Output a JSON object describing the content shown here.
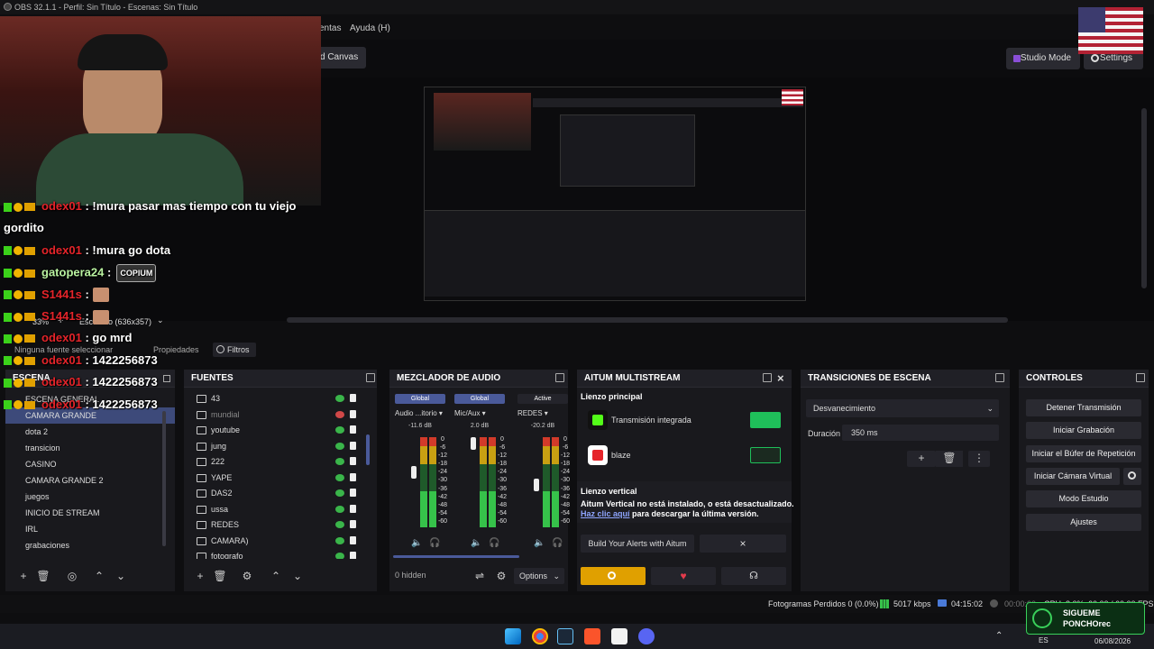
{
  "window": {
    "title": "OBS 32.1.1 - Perfil: Sin Título - Escenas: Sin Título"
  },
  "menu": {
    "items": [
      "entas",
      "Ayuda (H)"
    ]
  },
  "toolbar": {
    "canvas": "ld Canvas",
    "studio_mode": "Studio Mode",
    "settings": "Settings"
  },
  "preview_bar": {
    "zoom": "33%",
    "plus": "+",
    "scale": "Escalado (636x357)",
    "no_source": "Ninguna fuente seleccionar",
    "properties": "Propiedades",
    "filters": "Filtros"
  },
  "chat": [
    {
      "user": "odex01",
      "msg": ": !mura pasar mas tiempo con tu viejo",
      "color": "red"
    },
    {
      "user": "",
      "msg": "gordito",
      "color": "none"
    },
    {
      "user": "odex01",
      "msg": ": !mura go dota",
      "color": "red"
    },
    {
      "user": "gatopera24",
      "msg": ":",
      "emote": "COPIUM",
      "color": "green"
    },
    {
      "user": "S1441s",
      "msg": ":",
      "color": "red"
    },
    {
      "user": "S1441s",
      "msg": ":",
      "color": "red"
    },
    {
      "user": "odex01",
      "msg": ": go mrd",
      "color": "red"
    },
    {
      "user": "odex01",
      "msg": ": 1422256873",
      "color": "red"
    },
    {
      "user": "odex01",
      "msg": ": 1422256873",
      "color": "red"
    },
    {
      "user": "odex01",
      "msg": ": 1422256873",
      "color": "red"
    }
  ],
  "scenes": {
    "header": "ESCENA",
    "items": [
      "ESCENA GENERAL",
      "CAMARA GRANDE",
      "dota 2",
      "transicion",
      "CASINO",
      "CAMARA GRANDE 2",
      "juegos",
      "INICIO DE STREAM",
      "IRL",
      "grabaciones"
    ],
    "selected": 1
  },
  "sources": {
    "header": "FUENTES",
    "items": [
      {
        "name": "43",
        "visible": true
      },
      {
        "name": "mundial",
        "visible": false
      },
      {
        "name": "youtube",
        "visible": true
      },
      {
        "name": "jung",
        "visible": true
      },
      {
        "name": "222",
        "visible": true
      },
      {
        "name": "YAPE",
        "visible": true
      },
      {
        "name": "DAS2",
        "visible": true
      },
      {
        "name": "ussa",
        "visible": true
      },
      {
        "name": "REDES",
        "visible": true
      },
      {
        "name": "CAMARA)",
        "visible": true
      },
      {
        "name": "fotografo",
        "visible": true
      }
    ]
  },
  "mixer": {
    "header": "MEZCLADOR DE AUDIO",
    "channels": [
      {
        "tag": "Global",
        "select": "Audio ...itorio",
        "db": "-11.6 dB"
      },
      {
        "tag": "Global",
        "select": "Mic/Aux",
        "db": "2.0 dB"
      },
      {
        "tag": "Active",
        "select": "REDES",
        "db": "-20.2 dB"
      }
    ],
    "scale": [
      "0",
      "-6",
      "-12",
      "-18",
      "-24",
      "-30",
      "-36",
      "-42",
      "-48",
      "-54",
      "-60"
    ],
    "hidden": "0 hidden",
    "options": "Options"
  },
  "multistream": {
    "header": "AITUM MULTISTREAM",
    "main_label": "Lienzo principal",
    "rows": [
      {
        "name": "Transmisión integrada",
        "active": true
      },
      {
        "name": "blaze",
        "active": false
      }
    ],
    "vertical_label": "Lienzo vertical",
    "warning": "Aitum Vertical no está instalado, o está desactualizado.",
    "link": "Haz clic aquí",
    "link_rest": " para descargar la última versión.",
    "alerts": "Build Your Alerts with Aitum",
    "close": "×"
  },
  "transitions": {
    "header": "TRANSICIONES DE ESCENA",
    "type": "Desvanecimiento",
    "duration_label": "Duración",
    "duration": "350 ms"
  },
  "controls": {
    "header": "CONTROLES",
    "buttons": [
      "Detener Transmisión",
      "Iniciar Grabación",
      "Iniciar el Búfer de Repetición",
      "Iniciar Cámara Virtual",
      "Modo Estudio",
      "Ajustes"
    ]
  },
  "status": {
    "frames": "Fotogramas Perdidos 0 (0.0%)",
    "bitrate": "5017 kbps",
    "time_live": "04:15:02",
    "time_rec": "00:00:00",
    "cpu": "CPU: 3.0%",
    "fps": "60.00 / 60.00 FPS"
  },
  "overlay": {
    "follow_line1": "SIGUEME",
    "follow_line2": "PONCHOrec"
  },
  "taskbar": {
    "lang": "ES",
    "date": "06/08/2026"
  },
  "colors": {
    "accent": "#3d4a7a",
    "live_green": "#36c24a",
    "aitum_gold": "#e0a000",
    "red": "#e5242a"
  }
}
